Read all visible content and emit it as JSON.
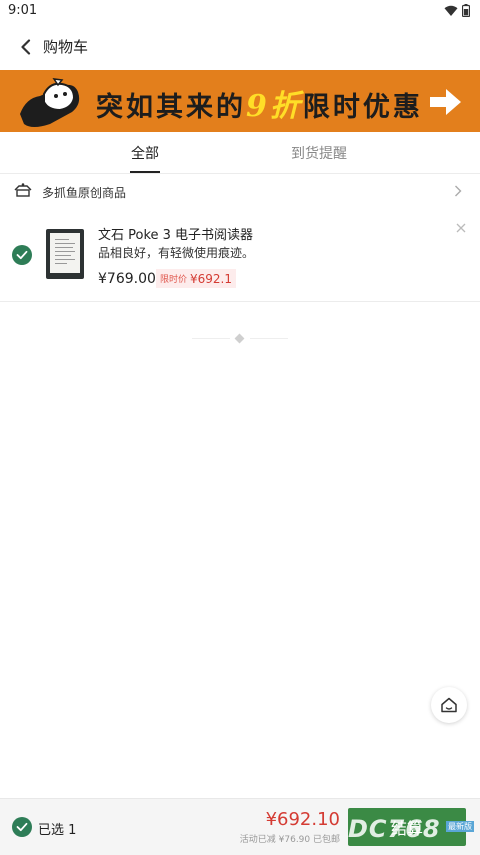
{
  "status": {
    "time": "9:01"
  },
  "header": {
    "title": "购物车"
  },
  "banner": {
    "text_before": "突如其来的",
    "text_highlight": "9折",
    "text_after": "限时优惠"
  },
  "tabs": [
    {
      "label": "全部",
      "active": true
    },
    {
      "label": "到货提醒",
      "active": false
    }
  ],
  "shop": {
    "name": "多抓鱼原创商品"
  },
  "cart_items": [
    {
      "title": "文石 Poke 3 电子书阅读器",
      "condition": "品相良好，有轻微使用痕迹。",
      "price": "¥769.00",
      "promo_label": "限时价",
      "promo_price": "¥692.1",
      "selected": true
    }
  ],
  "footer": {
    "selected_label": "已选 1",
    "total": "¥692.10",
    "detail": "活动已减 ¥76.90  已包邮",
    "checkout_label": "结算"
  },
  "watermark": {
    "text": "DC768",
    "sub": "最新版"
  },
  "colors": {
    "accent_green": "#2e7d57",
    "price_red": "#d43b33",
    "banner_orange": "#e37f1c",
    "checkout_green": "#3b8a45"
  },
  "icons": {
    "back": "back-arrow-icon",
    "shop": "shop-fish-icon",
    "chevron": "chevron-right-icon",
    "close": "close-icon",
    "check": "check-icon",
    "home": "home-icon",
    "wifi": "wifi-icon",
    "battery": "battery-icon"
  }
}
